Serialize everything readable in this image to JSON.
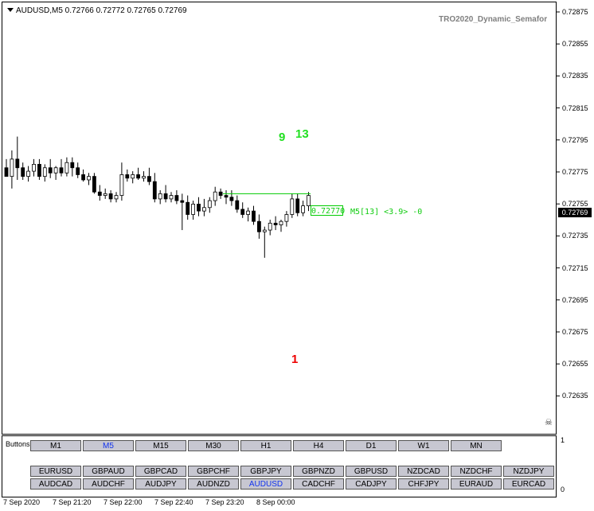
{
  "header": {
    "symbol_line": "AUDUSD,M5  0.72766 0.72772 0.72765 0.72769",
    "indicator_name": "TRO2020_Dynamic_Semafor"
  },
  "price_axis": {
    "labels": [
      "0.72875",
      "0.72855",
      "0.72835",
      "0.72815",
      "0.72795",
      "0.72775",
      "0.72755",
      "0.72735",
      "0.72715",
      "0.72695",
      "0.72675",
      "0.72655",
      "0.72635"
    ],
    "current_price": "0.72769"
  },
  "time_axis": {
    "labels": [
      "7 Sep 2020",
      "7 Sep 21:20",
      "7 Sep 22:00",
      "7 Sep 22:40",
      "7 Sep 23:20",
      "8 Sep 00:00"
    ]
  },
  "semafor": {
    "green_labels": [
      "9",
      "13"
    ],
    "red_labels": [
      "1"
    ]
  },
  "level": {
    "price_box": "0.72770",
    "info": "M5[13] <3.9> -0"
  },
  "panel": {
    "label": "Buttons",
    "timeframes": [
      "M1",
      "M5",
      "M15",
      "M30",
      "H1",
      "H4",
      "D1",
      "W1",
      "MN"
    ],
    "active_timeframe": "M5",
    "pairs_row1": [
      "EURUSD",
      "GBPAUD",
      "GBPCAD",
      "GBPCHF",
      "GBPJPY",
      "GBPNZD",
      "GBPUSD",
      "NZDCAD",
      "NZDCHF",
      "NZDJPY"
    ],
    "pairs_row2": [
      "AUDCAD",
      "AUDCHF",
      "AUDJPY",
      "AUDNZD",
      "AUDUSD",
      "CADCHF",
      "CADJPY",
      "CHFJPY",
      "EURAUD",
      "EURCAD"
    ],
    "active_pair": "AUDUSD",
    "scale_max": "1",
    "scale_min": "0"
  },
  "colors": {
    "bull_candle": "#ffffff",
    "bear_candle": "#000000",
    "semafor_high": "#22e022",
    "semafor_low": "#ee0000",
    "level_line": "#00cc00",
    "button_bg": "#c7c7d1",
    "active_button_text": "#1133ee"
  },
  "chart_data": {
    "type": "candlestick",
    "symbol": "AUDUSD",
    "timeframe": "M5",
    "ylim": [
      0.72625,
      0.72885
    ],
    "candles": [
      [
        0.72785,
        0.7279,
        0.7278,
        0.7278
      ],
      [
        0.7278,
        0.72795,
        0.72773,
        0.7279
      ],
      [
        0.7279,
        0.72803,
        0.72778,
        0.72785
      ],
      [
        0.72785,
        0.72788,
        0.72778,
        0.7278
      ],
      [
        0.7278,
        0.72786,
        0.72777,
        0.72783
      ],
      [
        0.72783,
        0.7279,
        0.7278,
        0.72787
      ],
      [
        0.72787,
        0.7279,
        0.72778,
        0.7278
      ],
      [
        0.7278,
        0.72787,
        0.72777,
        0.72785
      ],
      [
        0.72785,
        0.7279,
        0.72779,
        0.72782
      ],
      [
        0.72782,
        0.72786,
        0.72778,
        0.72785
      ],
      [
        0.72785,
        0.7279,
        0.7278,
        0.72782
      ],
      [
        0.72782,
        0.72791,
        0.7278,
        0.72788
      ],
      [
        0.72788,
        0.72791,
        0.7278,
        0.72785
      ],
      [
        0.72785,
        0.72788,
        0.72779,
        0.72781
      ],
      [
        0.72781,
        0.72784,
        0.72777,
        0.72778
      ],
      [
        0.72778,
        0.72782,
        0.72775,
        0.7278
      ],
      [
        0.7278,
        0.72782,
        0.7277,
        0.72771
      ],
      [
        0.72771,
        0.72775,
        0.72766,
        0.72769
      ],
      [
        0.72769,
        0.72773,
        0.72767,
        0.7277
      ],
      [
        0.7277,
        0.72772,
        0.72765,
        0.72767
      ],
      [
        0.72767,
        0.72771,
        0.72765,
        0.72769
      ],
      [
        0.72769,
        0.72788,
        0.72766,
        0.72781
      ],
      [
        0.72781,
        0.72784,
        0.72777,
        0.72779
      ],
      [
        0.72779,
        0.72783,
        0.72776,
        0.72781
      ],
      [
        0.72781,
        0.72785,
        0.72778,
        0.72779
      ],
      [
        0.72779,
        0.72783,
        0.72777,
        0.7278
      ],
      [
        0.7278,
        0.72785,
        0.72775,
        0.72777
      ],
      [
        0.72777,
        0.72782,
        0.72765,
        0.72767
      ],
      [
        0.72767,
        0.72772,
        0.72764,
        0.7277
      ],
      [
        0.7277,
        0.72775,
        0.72765,
        0.72767
      ],
      [
        0.72767,
        0.72771,
        0.72765,
        0.72769
      ],
      [
        0.72769,
        0.72772,
        0.72764,
        0.72766
      ],
      [
        0.72766,
        0.7277,
        0.72749,
        0.72765
      ],
      [
        0.72765,
        0.72769,
        0.72755,
        0.72758
      ],
      [
        0.72758,
        0.72766,
        0.72755,
        0.72764
      ],
      [
        0.72764,
        0.72768,
        0.72757,
        0.7276
      ],
      [
        0.7276,
        0.72767,
        0.72757,
        0.72762
      ],
      [
        0.72762,
        0.72768,
        0.72759,
        0.72766
      ],
      [
        0.72766,
        0.72774,
        0.72763,
        0.72771
      ],
      [
        0.72771,
        0.72773,
        0.72767,
        0.72769
      ],
      [
        0.72769,
        0.72772,
        0.72764,
        0.72768
      ],
      [
        0.72768,
        0.72772,
        0.72763,
        0.72766
      ],
      [
        0.72766,
        0.72769,
        0.72759,
        0.72761
      ],
      [
        0.72761,
        0.72765,
        0.72756,
        0.72758
      ],
      [
        0.72758,
        0.72762,
        0.72754,
        0.7276
      ],
      [
        0.7276,
        0.72763,
        0.72752,
        0.72754
      ],
      [
        0.72754,
        0.72758,
        0.72744,
        0.72748
      ],
      [
        0.72748,
        0.72751,
        0.72733,
        0.72749
      ],
      [
        0.72749,
        0.72755,
        0.72746,
        0.72753
      ],
      [
        0.72753,
        0.72757,
        0.72749,
        0.72752
      ],
      [
        0.72752,
        0.72755,
        0.72748,
        0.72754
      ],
      [
        0.72754,
        0.7276,
        0.72751,
        0.72758
      ],
      [
        0.72758,
        0.7277,
        0.72756,
        0.72767
      ],
      [
        0.72767,
        0.7277,
        0.72757,
        0.72759
      ],
      [
        0.72759,
        0.72766,
        0.72757,
        0.72763
      ],
      [
        0.72763,
        0.72771,
        0.7276,
        0.72769
      ]
    ],
    "level_price": 0.7277
  }
}
